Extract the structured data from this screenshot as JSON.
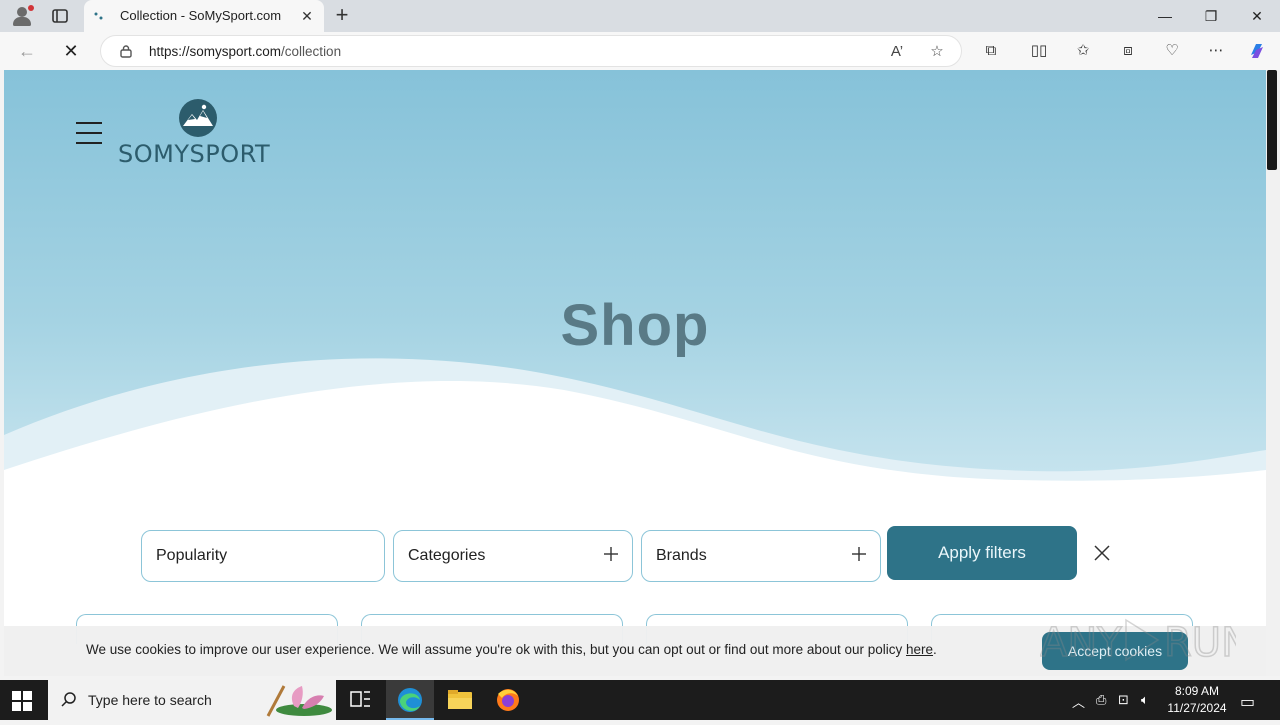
{
  "browser": {
    "tab_title": "Collection - SoMySport.com",
    "url_host": "https://somysport.com",
    "url_path": "/collection"
  },
  "site": {
    "logo_text": "SOMYSPORT",
    "hero_title": "Shop"
  },
  "filters": {
    "sort_label": "Popularity",
    "categories_label": "Categories",
    "brands_label": "Brands",
    "apply_label": "Apply filters"
  },
  "cookie": {
    "message": "We use cookies to improve our user experience. We will assume you're ok with this, but you can opt out or find out more about our policy ",
    "link_text": "here",
    "suffix": ".",
    "accept_label": "Accept cookies"
  },
  "taskbar": {
    "search_placeholder": "Type here to search",
    "time": "8:09 AM",
    "date": "11/27/2024"
  },
  "colors": {
    "accent": "#2e7388",
    "hero_top": "#86c2d9",
    "border": "#8cc5d8"
  }
}
